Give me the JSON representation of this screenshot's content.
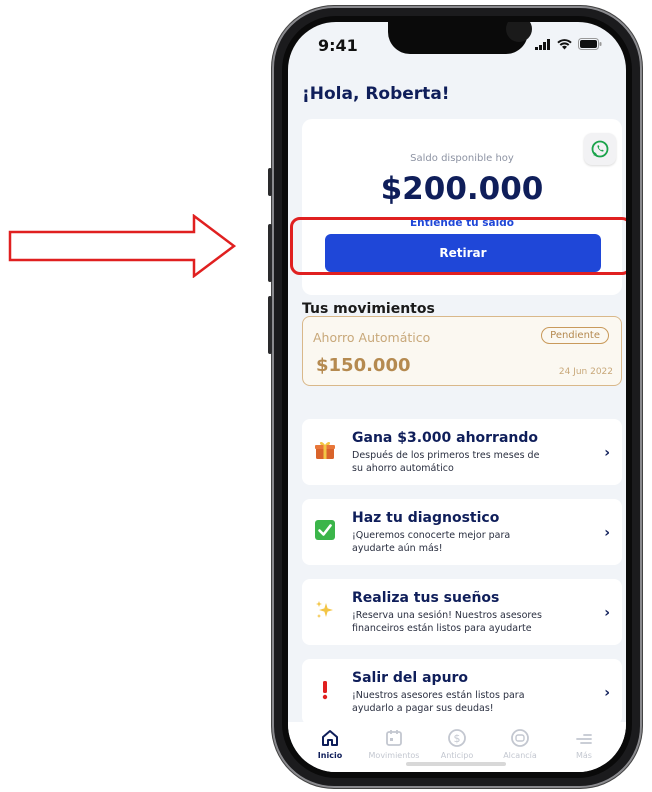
{
  "status_bar": {
    "time": "9:41"
  },
  "greeting": "¡Hola, Roberta!",
  "balance": {
    "label": "Saldo disponible hoy",
    "amount": "$200.000",
    "link": "Entiende tu saldo"
  },
  "withdraw_button": "Retirar",
  "movements": {
    "title": "Tus movimientos",
    "item": {
      "label": "Ahorro Automático",
      "status": "Pendiente",
      "amount": "$150.000",
      "date": "24 Jun 2022"
    }
  },
  "cards": [
    {
      "icon": "gift-icon",
      "title": "Gana $3.000 ahorrando",
      "desc": "Después de los primeros tres meses de su ahorro automático"
    },
    {
      "icon": "check-icon",
      "title": "Haz tu diagnostico",
      "desc": "¡Queremos conocerte mejor para ayudarte aún más!"
    },
    {
      "icon": "sparkles-icon",
      "title": "Realiza tus sueños",
      "desc": "¡Reserva una sesión! Nuestros asesores financeiros están listos para ayudarte"
    },
    {
      "icon": "exclamation-icon",
      "title": "Salir del apuro",
      "desc": "¡Nuestros asesores están listos para ayudarlo a pagar sus deudas!"
    }
  ],
  "tabs": [
    {
      "label": "Inicio",
      "icon": "home-icon",
      "active": true
    },
    {
      "label": "Movimientos",
      "icon": "calendar-icon"
    },
    {
      "label": "Anticipo",
      "icon": "dollar-icon"
    },
    {
      "label": "Alcancía",
      "icon": "piggy-icon"
    },
    {
      "label": "Más",
      "icon": "menu-icon"
    }
  ],
  "colors": {
    "primary": "#1f47d8",
    "navy": "#0f1e5a",
    "highlight": "#e02020",
    "accent_gold": "#b58a50"
  }
}
